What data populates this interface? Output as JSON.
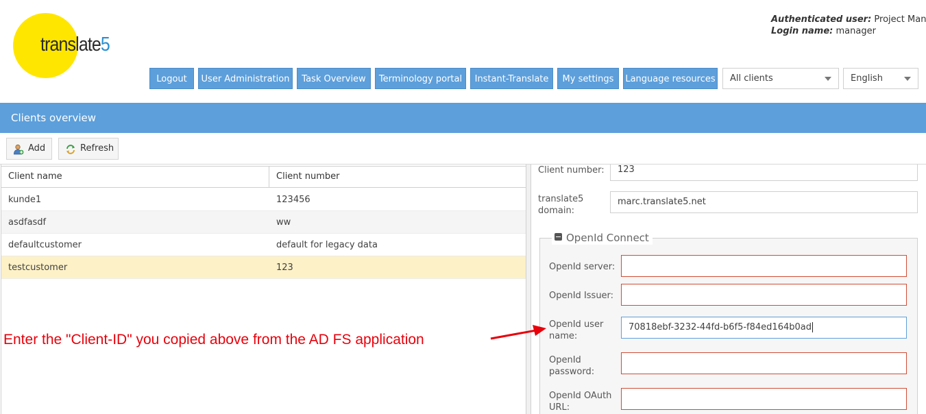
{
  "logo": {
    "text_main": "translate",
    "text_num": "5",
    "circle_color": "#ffe600"
  },
  "user": {
    "auth_label": "Authenticated user:",
    "auth_value": " Project Manager",
    "login_label": "Login name:",
    "login_value": " manager"
  },
  "nav": {
    "logout": "Logout",
    "user_admin": "User Administration",
    "task_overview": "Task Overview",
    "terminology": "Terminology portal",
    "instant_translate": "Instant-Translate",
    "my_settings": "My settings",
    "language_resources": "Language resources"
  },
  "client_select": {
    "value": "All clients"
  },
  "language_select": {
    "value": "English"
  },
  "panel": {
    "title": "Clients overview"
  },
  "toolbar": {
    "add": "Add",
    "refresh": "Refresh"
  },
  "grid": {
    "columns": [
      "Client name",
      "Client number"
    ],
    "rows": [
      {
        "name": "kunde1",
        "number": "123456"
      },
      {
        "name": "asdfasdf",
        "number": "ww"
      },
      {
        "name": "defaultcustomer",
        "number": "default for legacy data"
      },
      {
        "name": "testcustomer",
        "number": "123",
        "selected": true
      }
    ]
  },
  "form": {
    "client_number_label": "Client number:",
    "client_number_value": "123",
    "domain_label_1": "translate5",
    "domain_label_2": "domain:",
    "domain_value": "marc.translate5.net",
    "openid_legend": "OpenId Connect",
    "openid_server_label": "OpenId server:",
    "openid_server_value": "",
    "openid_issuer_label": "OpenId Issuer:",
    "openid_issuer_value": "",
    "openid_user_label_1": "OpenId user",
    "openid_user_label_2": "name:",
    "openid_user_value": "70818ebf-3232-44fd-b6f5-f84ed164b0ad",
    "openid_password_label_1": "OpenId",
    "openid_password_label_2": "password:",
    "openid_password_value": "",
    "openid_oauth_label_1": "OpenId OAuth",
    "openid_oauth_label_2": "URL:",
    "openid_oauth_value": ""
  },
  "annotation": {
    "text": "Enter the \"Client-ID\" you copied above from the AD FS application",
    "color": "#e8000b"
  },
  "colors": {
    "accent": "#5c9fdb",
    "selected_row": "#fdf1c7",
    "error_border": "#cf4c35"
  }
}
